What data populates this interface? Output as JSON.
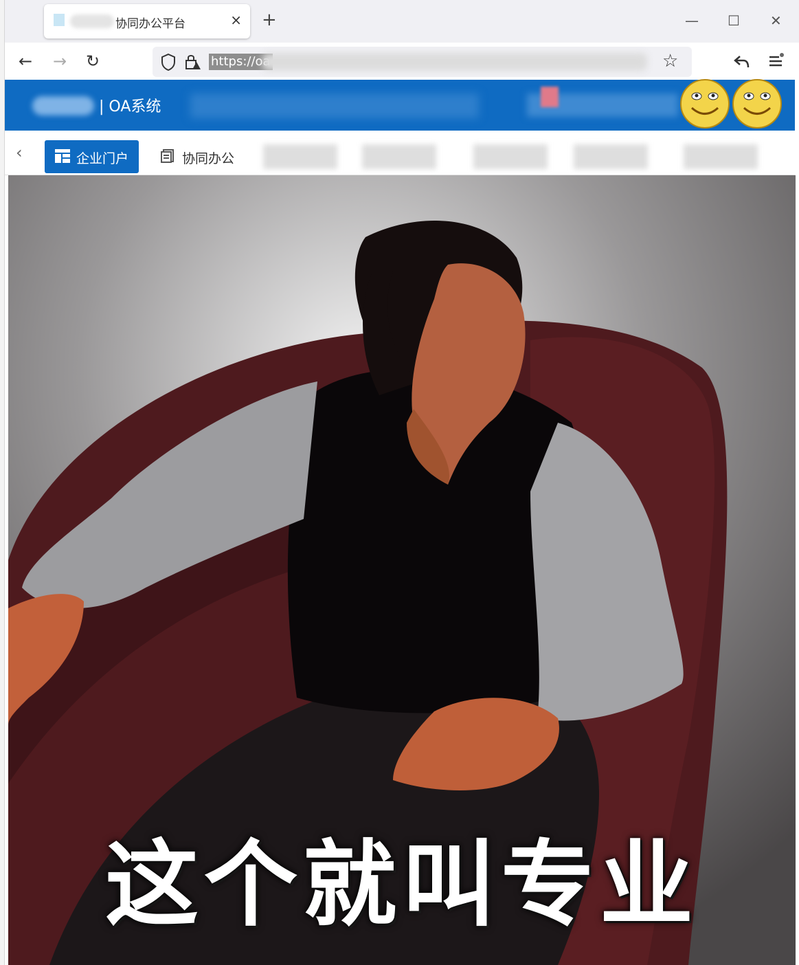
{
  "browser": {
    "tab_title": "协同办公平台",
    "tab_close": "×",
    "new_tab": "+",
    "minimize": "—",
    "maximize": "☐",
    "close": "✕",
    "url_visible": "https://oa",
    "back_icon": "←",
    "forward_icon": "→",
    "reload_icon": "↻",
    "star_icon": "☆"
  },
  "oa": {
    "system_title": "| OA系统"
  },
  "menu": {
    "back_icon": "‹",
    "items": [
      {
        "label": "企业门户",
        "active": true
      },
      {
        "label": "协同办公",
        "active": false
      }
    ]
  },
  "meme": {
    "caption": "这个就叫专业"
  },
  "colors": {
    "oa_blue": "#0f6bc2",
    "tabstrip": "#f0f0f4"
  }
}
